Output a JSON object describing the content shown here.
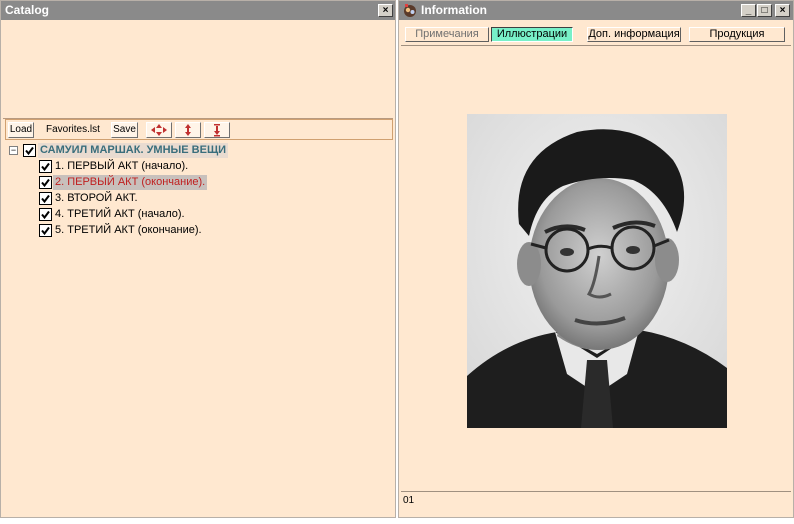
{
  "catalog": {
    "title": "Catalog",
    "close_label": "×",
    "toolbar": {
      "load_label": "Load",
      "file_name": "Favorites.lst",
      "save_label": "Save"
    },
    "tree": {
      "root_label": "САМУИЛ МАРШАК. УМНЫЕ ВЕЩИ",
      "expander": "−",
      "items": [
        {
          "label": "1. ПЕРВЫЙ АКТ (начало).",
          "checked": true,
          "selected": false
        },
        {
          "label": "2. ПЕРВЫЙ АКТ (окончание).",
          "checked": true,
          "selected": true
        },
        {
          "label": "3. ВТОРОЙ АКТ.",
          "checked": true,
          "selected": false
        },
        {
          "label": "4. ТРЕТИЙ АКТ (начало).",
          "checked": true,
          "selected": false
        },
        {
          "label": "5. ТРЕТИЙ АКТ (окончание).",
          "checked": true,
          "selected": false
        }
      ]
    }
  },
  "info": {
    "title": "Information",
    "minimize_label": "_",
    "maximize_label": "□",
    "close_label": "×",
    "tabs": [
      {
        "label": "Примечания",
        "state": "inactive"
      },
      {
        "label": "Иллюстрации",
        "state": "active"
      },
      {
        "label": "Доп. информация",
        "state": "normal"
      },
      {
        "label": "Продукция",
        "state": "normal"
      }
    ],
    "status_text": "01"
  },
  "colors": {
    "panel_bg": "#ffe8d0",
    "titlebar": "#8a8a8a",
    "active_tab": "#78f0c8",
    "selected_text": "#c02020",
    "root_text": "#3a6e7c"
  }
}
